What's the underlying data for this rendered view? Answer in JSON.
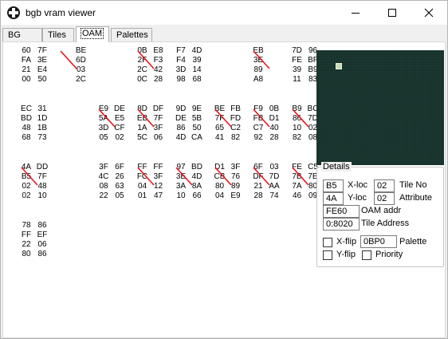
{
  "window": {
    "title": "bgb vram viewer"
  },
  "tabs": [
    {
      "label": "BG map"
    },
    {
      "label": "Tiles"
    },
    {
      "label": "OAM"
    },
    {
      "label": "Palettes"
    }
  ],
  "sprites": [
    {
      "left": [
        "60",
        "FA",
        "21",
        "00"
      ],
      "right": [
        "7F",
        "3E",
        "E4",
        "50"
      ],
      "marked": false
    },
    {
      "left": [
        "",
        "",
        "",
        ""
      ],
      "right": [
        "BE",
        "6D",
        "03",
        "2C"
      ],
      "marked": true
    },
    {
      "left": [
        "0B",
        "2F",
        "2C",
        "0C"
      ],
      "right": [
        "E8",
        "F3",
        "42",
        "28"
      ],
      "marked": true
    },
    {
      "left": [
        "F7",
        "F4",
        "3D",
        "98"
      ],
      "right": [
        "4D",
        "39",
        "14",
        "68"
      ],
      "marked": false
    },
    {
      "left": [
        "EB",
        "3E",
        "89",
        "A8"
      ],
      "right": [
        "",
        "",
        "",
        ""
      ],
      "marked": true
    },
    {
      "left": [
        "7D",
        "FE",
        "39",
        "11"
      ],
      "right": [
        "96",
        "BF",
        "B9",
        "83"
      ],
      "marked": false
    },
    {
      "left": [
        "EC",
        "BD",
        "48",
        "68"
      ],
      "right": [
        "31",
        "1D",
        "1B",
        "73"
      ],
      "marked": false
    },
    {
      "left": [
        "E9",
        "5A",
        "3D",
        "05"
      ],
      "right": [
        "DE",
        "E5",
        "CF",
        "02"
      ],
      "marked": true
    },
    {
      "left": [
        "8D",
        "EB",
        "1A",
        "5C"
      ],
      "right": [
        "DF",
        "7F",
        "3F",
        "06"
      ],
      "marked": true
    },
    {
      "left": [
        "9D",
        "DE",
        "86",
        "4D"
      ],
      "right": [
        "9E",
        "5B",
        "50",
        "CA"
      ],
      "marked": false
    },
    {
      "left": [
        "BE",
        "7F",
        "65",
        "41"
      ],
      "right": [
        "FB",
        "FD",
        "C2",
        "82"
      ],
      "marked": true
    },
    {
      "left": [
        "F9",
        "FB",
        "C7",
        "92"
      ],
      "right": [
        "0B",
        "D1",
        "40",
        "28"
      ],
      "marked": true
    },
    {
      "left": [
        "B9",
        "86",
        "10",
        "82"
      ],
      "right": [
        "BC",
        "7D",
        "02",
        "08"
      ],
      "marked": true
    },
    {
      "left": [
        "4A",
        "B5",
        "02",
        "02"
      ],
      "right": [
        "DD",
        "7F",
        "48",
        "10"
      ],
      "marked": true
    },
    {
      "left": [
        "3F",
        "4C",
        "08",
        "22"
      ],
      "right": [
        "6F",
        "26",
        "63",
        "05"
      ],
      "marked": false
    },
    {
      "left": [
        "FF",
        "FC",
        "04",
        "01"
      ],
      "right": [
        "FF",
        "3F",
        "12",
        "47"
      ],
      "marked": true
    },
    {
      "left": [
        "97",
        "3E",
        "3A",
        "10"
      ],
      "right": [
        "BD",
        "4D",
        "8A",
        "66"
      ],
      "marked": true
    },
    {
      "left": [
        "D1",
        "CB",
        "80",
        "04"
      ],
      "right": [
        "3F",
        "76",
        "89",
        "E9"
      ],
      "marked": true
    },
    {
      "left": [
        "6F",
        "DF",
        "21",
        "28"
      ],
      "right": [
        "03",
        "7D",
        "AA",
        "74"
      ],
      "marked": true
    },
    {
      "left": [
        "FE",
        "7B",
        "7A",
        "46"
      ],
      "right": [
        "C5",
        "7E",
        "80",
        "09"
      ],
      "marked": true
    },
    {
      "left": [
        "78",
        "FF",
        "22",
        "80"
      ],
      "right": [
        "86",
        "EF",
        "06",
        "86"
      ],
      "marked": false
    }
  ],
  "details": {
    "legend": "Details",
    "x_value": "B5",
    "x_label": "X-loc",
    "tile_value": "02",
    "tile_label": "Tile No",
    "y_value": "4A",
    "y_label": "Y-loc",
    "attr_value": "02",
    "attr_label": "Attribute",
    "oam_value": "FE60",
    "oam_label": "OAM addr",
    "tile_addr_value": "0:8020",
    "tile_addr_label": "Tile Address",
    "xflip_label": "X-flip",
    "palette_value": "0BP0",
    "palette_label": "Palette",
    "yflip_label": "Y-flip",
    "priority_label": "Priority"
  },
  "colors": {
    "preview_bg": "#1e3f38",
    "mark_red": "#e8141e"
  }
}
